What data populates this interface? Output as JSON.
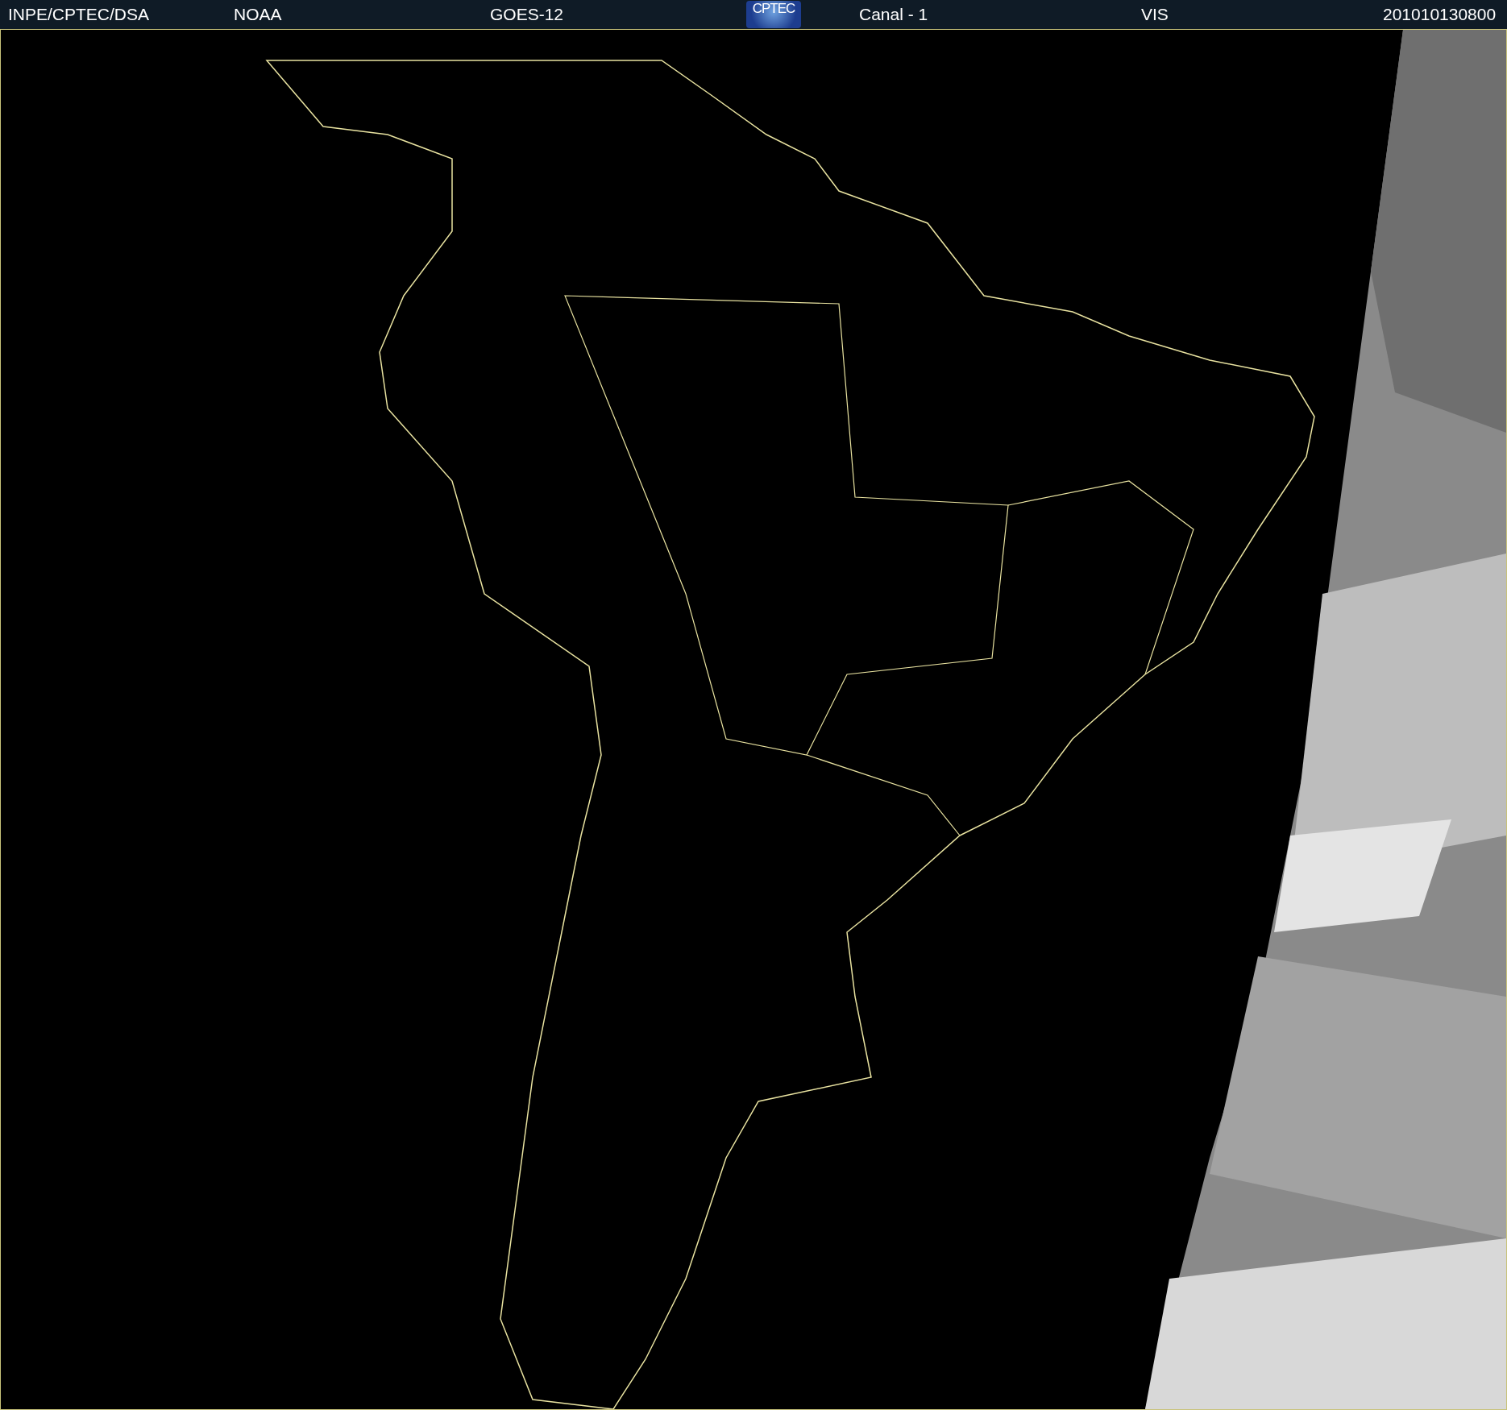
{
  "header": {
    "items": [
      {
        "kind": "text",
        "text": "INPE/CPTEC/DSA"
      },
      {
        "kind": "text",
        "text": "NOAA"
      },
      {
        "kind": "text",
        "text": "GOES-12"
      },
      {
        "kind": "logo",
        "text": "CPTEC"
      },
      {
        "kind": "text",
        "text": "Canal - 1"
      },
      {
        "kind": "text",
        "text": "VIS"
      },
      {
        "kind": "text",
        "text": "201010130800"
      }
    ]
  }
}
